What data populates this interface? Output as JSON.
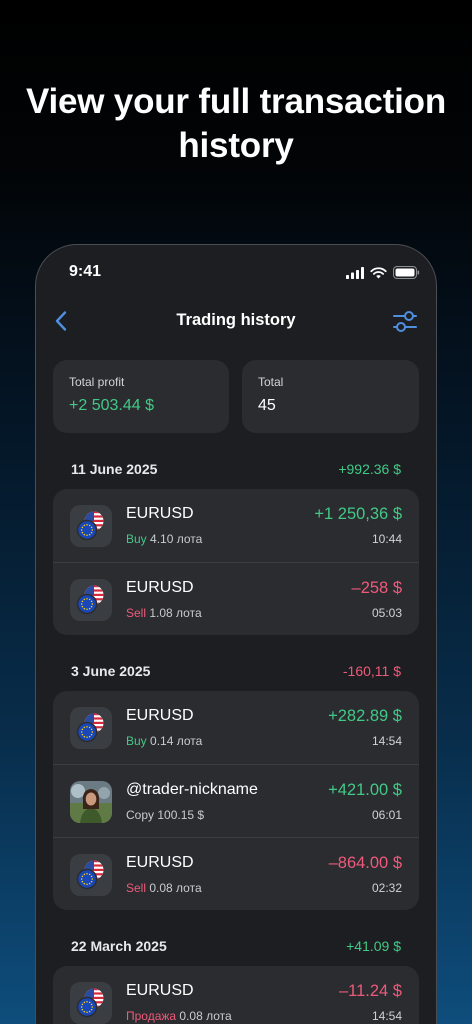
{
  "headline": {
    "line1": "View your full transaction",
    "line2": "history"
  },
  "status_bar": {
    "time": "9:41"
  },
  "nav": {
    "title": "Trading history"
  },
  "stats": {
    "profit_label": "Total profit",
    "profit_value": "+2 503.44 $",
    "total_label": "Total",
    "total_value": "45"
  },
  "sections": [
    {
      "date": "11 June 2025",
      "sum": "+992.36 $",
      "rows": [
        {
          "name": "EURUSD",
          "side": "Buy",
          "detail": " 4.10 лота",
          "amount": "+1 250,36 $",
          "time": "10:44"
        },
        {
          "name": "EURUSD",
          "side": "Sell",
          "detail": " 1.08 лота",
          "amount": "–258 $",
          "time": "05:03"
        }
      ]
    },
    {
      "date": "3 June 2025",
      "sum": "-160,11 $",
      "rows": [
        {
          "name": "EURUSD",
          "side": "Buy",
          "detail": " 0.14 лота",
          "amount": "+282.89 $",
          "time": "14:54"
        },
        {
          "name": "@trader-nickname",
          "side": "",
          "detail": "Copy 100.15 $",
          "amount": "+421.00 $",
          "time": "06:01"
        },
        {
          "name": "EURUSD",
          "side": "Sell",
          "detail": " 0.08 лота",
          "amount": "–864.00 $",
          "time": "02:32"
        }
      ]
    },
    {
      "date": "22 March 2025",
      "sum": "+41.09 $",
      "rows": [
        {
          "name": "EURUSD",
          "side": "Продажа",
          "detail": " 0.08 лота",
          "amount": "–11.24 $",
          "time": "14:54"
        }
      ]
    }
  ],
  "colors": {
    "profit": "#43c986",
    "loss": "#ef5a7b",
    "accent": "#4f8fe0",
    "card": "#2a2c30",
    "phone": "#1c1e21"
  },
  "icons": {
    "back": "chevron-left-icon",
    "filter": "sliders-icon",
    "currency_pair": "eur-usd-flags-icon",
    "signal": "cellular-signal-icon",
    "wifi": "wifi-icon",
    "battery": "battery-icon"
  }
}
